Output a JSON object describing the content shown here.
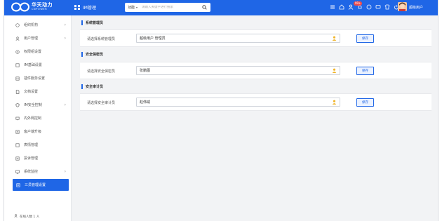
{
  "brand": {
    "name_cn": "华天动力",
    "name_en": "CNPOWER"
  },
  "header": {
    "module_title": "IM管理",
    "search": {
      "scope": "功能",
      "placeholder": "请输入关键字进行搜索"
    },
    "badge": "99+",
    "user_name": "超级用户"
  },
  "sidebar": {
    "items": [
      {
        "label": "组织机构",
        "icon": "org-icon",
        "has_children": true
      },
      {
        "label": "用户管理",
        "icon": "user-icon",
        "has_children": true
      },
      {
        "label": "权限组设置",
        "icon": "key-icon",
        "has_children": false
      },
      {
        "label": "IM基础设置",
        "icon": "settings-icon",
        "has_children": false
      },
      {
        "label": "插件服务设置",
        "icon": "plugin-icon",
        "has_children": false
      },
      {
        "label": "文档设置",
        "icon": "doc-icon",
        "has_children": false
      },
      {
        "label": "IM安全控制",
        "icon": "shield-icon",
        "has_children": true
      },
      {
        "label": "内外网控制",
        "icon": "network-icon",
        "has_children": false
      },
      {
        "label": "客户端升级",
        "icon": "upgrade-icon",
        "has_children": false
      },
      {
        "label": "表情管理",
        "icon": "emoji-icon",
        "has_children": false
      },
      {
        "label": "投诉管理",
        "icon": "complaint-icon",
        "has_children": false
      },
      {
        "label": "系统监控",
        "icon": "monitor-icon",
        "has_children": true
      },
      {
        "label": "三员管理设置",
        "icon": "three-admins-icon",
        "has_children": false,
        "active": true
      }
    ],
    "online": "在线人数 1 人"
  },
  "sections": [
    {
      "title": "系统管理员",
      "label": "请选择系统管理员",
      "value": "超级用户    管理员",
      "save": "保存"
    },
    {
      "title": "安全保密员",
      "label": "请选择安全保密员",
      "value": "张鹏图",
      "save": "保存"
    },
    {
      "title": "安全审计员",
      "label": "请选择安全审计员",
      "value": "赵伟威",
      "save": "保存"
    }
  ],
  "colors": {
    "primary": "#1f66e6",
    "field_icon": "#f0b429",
    "badge": "#f04b4b"
  }
}
